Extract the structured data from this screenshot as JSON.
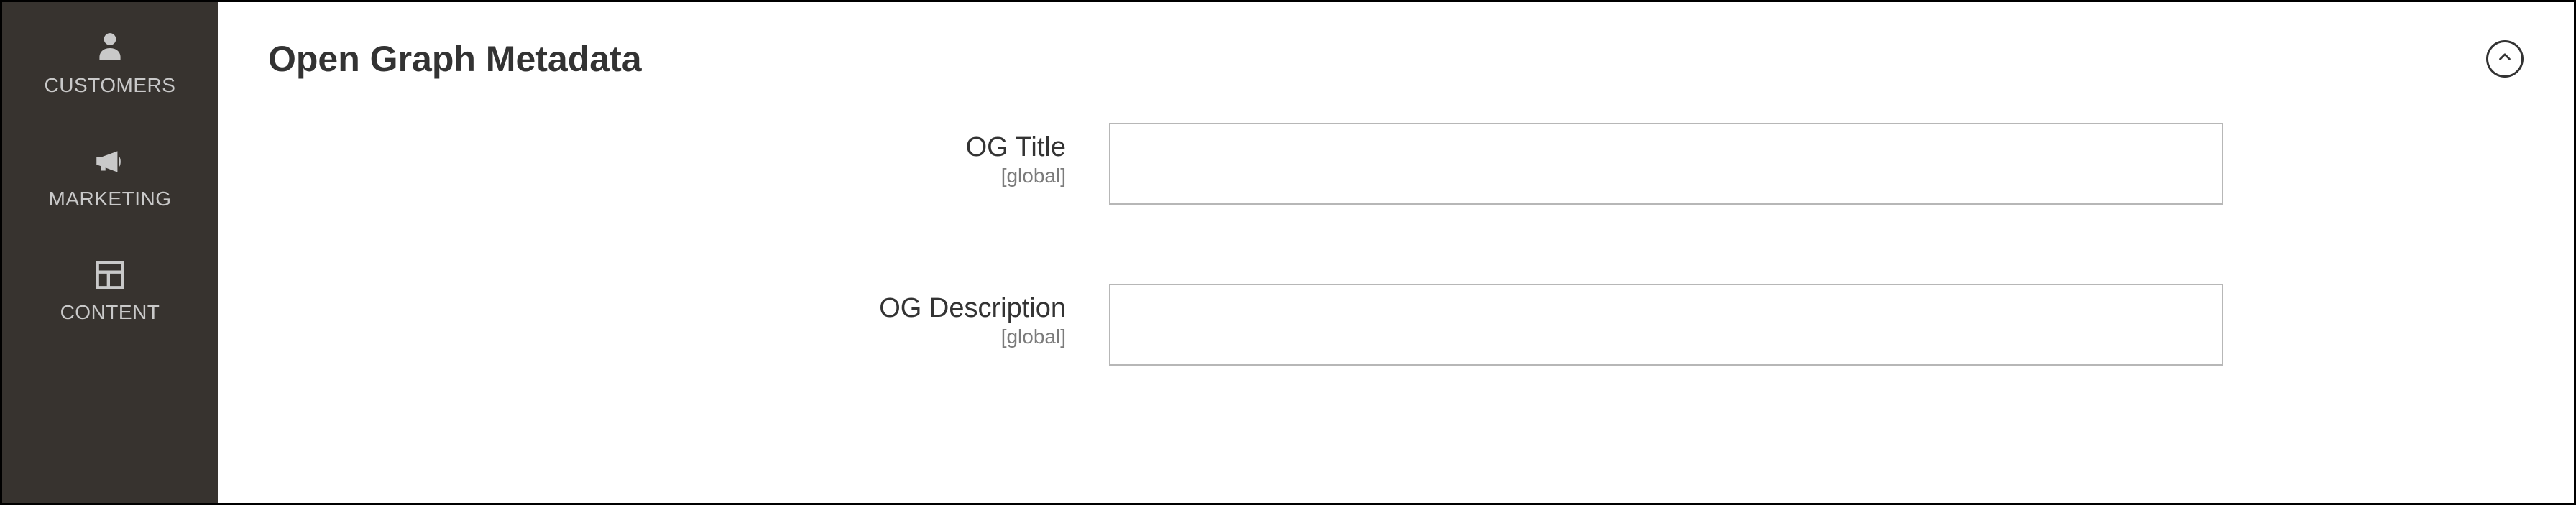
{
  "sidebar": {
    "items": [
      {
        "id": "customers",
        "label": "CUSTOMERS",
        "icon": "person-icon"
      },
      {
        "id": "marketing",
        "label": "MARKETING",
        "icon": "megaphone-icon"
      },
      {
        "id": "content",
        "label": "CONTENT",
        "icon": "layout-icon"
      }
    ]
  },
  "section": {
    "title": "Open Graph Metadata",
    "collapse_state": "expanded"
  },
  "fields": {
    "og_title": {
      "label": "OG Title",
      "scope": "[global]",
      "value": "",
      "placeholder": ""
    },
    "og_description": {
      "label": "OG Description",
      "scope": "[global]",
      "value": "",
      "placeholder": ""
    }
  },
  "colors": {
    "sidebar_bg": "#37332f",
    "sidebar_fg": "#c9c9c9",
    "border": "#b7b7b7",
    "text": "#333333",
    "scope": "#7b7b7b"
  }
}
